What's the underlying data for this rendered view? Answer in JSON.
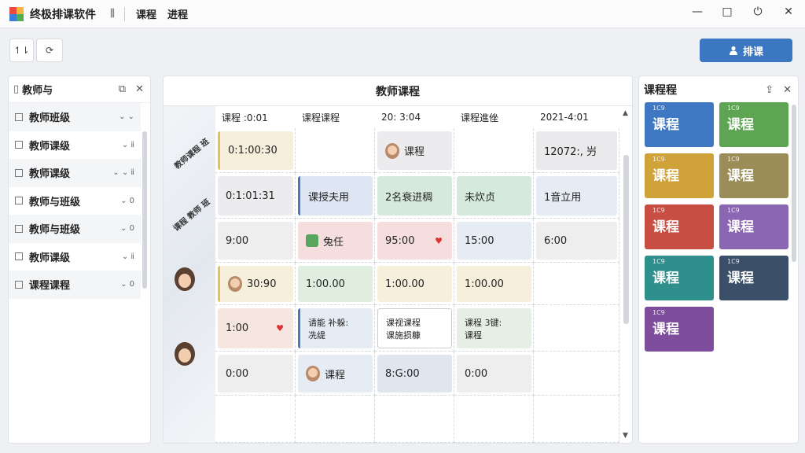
{
  "titlebar": {
    "app_title": "终极排课软件",
    "menu_icon_glyph": "⫼",
    "menu": [
      "课程",
      "进程"
    ],
    "controls": [
      "—",
      "□",
      "⏻",
      "✕"
    ]
  },
  "toolbar": {
    "btn1_label": "↿⇂",
    "btn2_label": "⟳",
    "primary_label": "排课",
    "primary_icon": "person-icon",
    "primary_color": "#3b78c1"
  },
  "left_panel": {
    "title": "教师与",
    "items": [
      {
        "label": "教师班级",
        "tail": "⌄ ⌄"
      },
      {
        "label": "教师课级",
        "tail": "⌄ ⅱ"
      },
      {
        "label": "教师课级",
        "tail": "⌄ ⌄ ⅱ"
      },
      {
        "label": "教师与班级",
        "tail": "⌄ 0"
      },
      {
        "label": "教师与班级",
        "tail": "⌄ 0"
      },
      {
        "label": "教师课级",
        "tail": "⌄ ⅱ"
      },
      {
        "label": "课程课程",
        "tail": "⌄ 0"
      }
    ]
  },
  "schedule": {
    "title": "教师课程",
    "col_headers": [
      "课程 :0:01",
      "课程课程",
      "20: 3:04",
      "课程進侳",
      "2021-4:01"
    ],
    "row_labels": [
      "教师课程 班",
      "课程 教师 班",
      "",
      "",
      "",
      ""
    ],
    "events": [
      {
        "row": 0,
        "col": 0,
        "text": "0:1:00:30",
        "color": "#f6efdc",
        "line": "yellow"
      },
      {
        "row": 0,
        "col": 2,
        "text": "课程",
        "color": "#ececee",
        "avatar": true
      },
      {
        "row": 0,
        "col": 4,
        "text": "12072:, 屶",
        "color": "#eaeaec"
      },
      {
        "row": 1,
        "col": 0,
        "text": "0:1:01:31",
        "color": "#ececee"
      },
      {
        "row": 1,
        "col": 1,
        "text": "课授夫用",
        "color": "#dde6f2",
        "line": "blue"
      },
      {
        "row": 1,
        "col": 2,
        "text": "2名衰进稠",
        "color": "#d6eadc"
      },
      {
        "row": 1,
        "col": 3,
        "text": "未炊贞",
        "color": "#d6eadc"
      },
      {
        "row": 1,
        "col": 4,
        "text": "1音立用",
        "color": "#e6ecf4"
      },
      {
        "row": 2,
        "col": 0,
        "text": "9:00",
        "color": "#eeeeee"
      },
      {
        "row": 2,
        "col": 1,
        "text": "兔任",
        "color": "#f6dede",
        "icon": true
      },
      {
        "row": 2,
        "col": 2,
        "text": "95:00",
        "color": "#f6dede",
        "heart": true
      },
      {
        "row": 2,
        "col": 3,
        "text": "15:00",
        "color": "#e6ecf4"
      },
      {
        "row": 2,
        "col": 4,
        "text": "6:00",
        "color": "#eeeeee"
      },
      {
        "row": 3,
        "col": 0,
        "text": "30:90",
        "color": "#f6efdc",
        "line": "yellow",
        "avatar": true
      },
      {
        "row": 3,
        "col": 1,
        "text": "1:00.00",
        "color": "#e0eee0"
      },
      {
        "row": 3,
        "col": 2,
        "text": "1:00.00",
        "color": "#f6efdc"
      },
      {
        "row": 3,
        "col": 3,
        "text": "1:00.00",
        "color": "#f6efdc"
      },
      {
        "row": 4,
        "col": 0,
        "text": "1:00",
        "color": "#f6e6e0",
        "heart": true
      },
      {
        "row": 4,
        "col": 1,
        "text": "请能 补躲:\n冼缇",
        "color": "#e6ecf4",
        "line": "blue"
      },
      {
        "row": 4,
        "col": 2,
        "text": "课视课程\n课施损糠",
        "color": "#ffffff",
        "border": true
      },
      {
        "row": 4,
        "col": 3,
        "text": "课程 3键:\n课程",
        "color": "#e6efe4"
      },
      {
        "row": 5,
        "col": 0,
        "text": "0:00",
        "color": "#eeeeee"
      },
      {
        "row": 5,
        "col": 1,
        "text": "课程",
        "color": "#e6ecf4",
        "avatar": true
      },
      {
        "row": 5,
        "col": 2,
        "text": "8:G:00",
        "color": "#dfe6ef"
      },
      {
        "row": 5,
        "col": 3,
        "text": "0:00",
        "color": "#eeeeee"
      }
    ]
  },
  "right_panel": {
    "title": "课程程",
    "tiles": [
      {
        "code": "1C9",
        "name": "课程",
        "color": "#3e78c2"
      },
      {
        "code": "1C9",
        "name": "课程",
        "color": "#5ea553"
      },
      {
        "code": "1C9",
        "name": "课程",
        "color": "#d0a23a"
      },
      {
        "code": "1C9",
        "name": "课程",
        "color": "#9a8d58"
      },
      {
        "code": "1C9",
        "name": "课程",
        "color": "#c84e43"
      },
      {
        "code": "1C9",
        "name": "课程",
        "color": "#8b67b3"
      },
      {
        "code": "1C9",
        "name": "课程",
        "color": "#2f8f8d"
      },
      {
        "code": "1C9",
        "name": "课程",
        "color": "#3b5068"
      },
      {
        "code": "1C9",
        "name": "课程",
        "color": "#7e4e9c"
      }
    ]
  }
}
